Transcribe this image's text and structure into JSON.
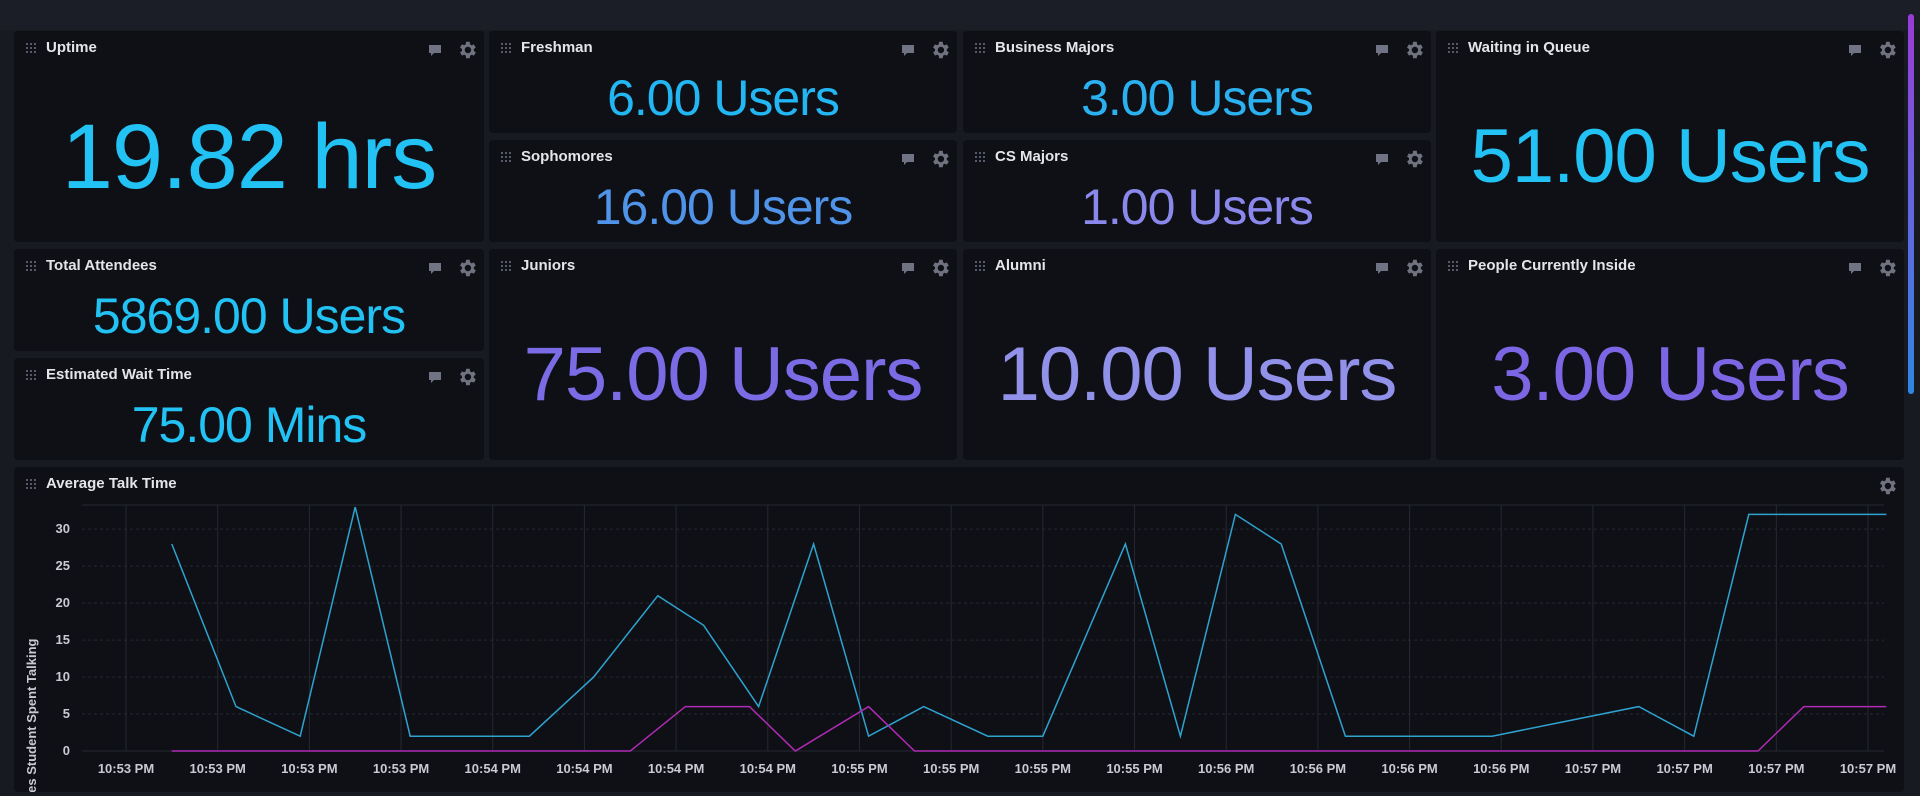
{
  "colors": {
    "cyan": "#22c3f4",
    "blue": "#4f94e8",
    "violet": "#7d73e6",
    "lavender": "#9191ea",
    "line_teal": "#2ea3cf",
    "line_magenta": "#b12ab5"
  },
  "cells": [
    {
      "title": "Uptime",
      "value": "19.82 hrs",
      "color": "#22c3f4"
    },
    {
      "title": "Freshman",
      "value": "6.00 Users",
      "color": "#22b6f2"
    },
    {
      "title": "Business Majors",
      "value": "3.00 Users",
      "color": "#2bb0f0"
    },
    {
      "title": "Waiting in Queue",
      "value": "51.00 Users",
      "color": "#22c3f4"
    },
    {
      "title": "Sophomores",
      "value": "16.00 Users",
      "color": "#4f94e8"
    },
    {
      "title": "CS Majors",
      "value": "1.00 Users",
      "color": "#8a88ea"
    },
    {
      "title": "Total Attendees",
      "value": "5869.00 Users",
      "color": "#22c3f4"
    },
    {
      "title": "Juniors",
      "value": "75.00 Users",
      "color": "#7b6ce6"
    },
    {
      "title": "Alumni",
      "value": "10.00 Users",
      "color": "#9191ea"
    },
    {
      "title": "People Currently Inside",
      "value": "3.00 Users",
      "color": "#7d66e4"
    },
    {
      "title": "Estimated Wait Time",
      "value": "75.00 Mins",
      "color": "#22c3f4"
    }
  ],
  "graph": {
    "title": "Average Talk Time"
  },
  "chart_data": {
    "type": "line",
    "ylabel": "Minutes Student Spent Talking",
    "xlabel": "",
    "ylim": [
      0,
      33
    ],
    "y_ticks": [
      0,
      5,
      10,
      15,
      20,
      25,
      30
    ],
    "x_ticks": [
      "10:53 PM",
      "10:53 PM",
      "10:53 PM",
      "10:53 PM",
      "10:54 PM",
      "10:54 PM",
      "10:54 PM",
      "10:54 PM",
      "10:55 PM",
      "10:55 PM",
      "10:55 PM",
      "10:55 PM",
      "10:56 PM",
      "10:56 PM",
      "10:56 PM",
      "10:56 PM",
      "10:57 PM",
      "10:57 PM",
      "10:57 PM",
      "10:57 PM"
    ],
    "grid": true,
    "series": [
      {
        "color": "#2ea3cf",
        "x": [
          0.5,
          1.2,
          1.9,
          2.5,
          3.1,
          4.4,
          5.1,
          5.8,
          6.3,
          6.9,
          7.5,
          8.1,
          8.7,
          9.4,
          10.0,
          10.9,
          11.5,
          12.1,
          12.6,
          13.3,
          14.0,
          14.9,
          16.5,
          17.1,
          17.7,
          18.3,
          19.2
        ]
      },
      {
        "color": "#b12ab5",
        "x": [
          0.5,
          5.5,
          6.1,
          6.8,
          7.3,
          8.1,
          8.6,
          16.6,
          17.8,
          18.3,
          19.2
        ]
      }
    ],
    "series_y": [
      [
        28,
        6,
        2,
        33,
        2,
        2,
        10,
        21,
        17,
        6,
        28,
        2,
        6,
        2,
        2,
        28,
        2,
        32,
        28,
        2,
        2,
        2,
        6,
        2,
        32,
        32,
        32
      ],
      [
        0,
        0,
        6,
        6,
        0,
        6,
        0,
        0,
        0,
        6,
        6
      ]
    ]
  }
}
